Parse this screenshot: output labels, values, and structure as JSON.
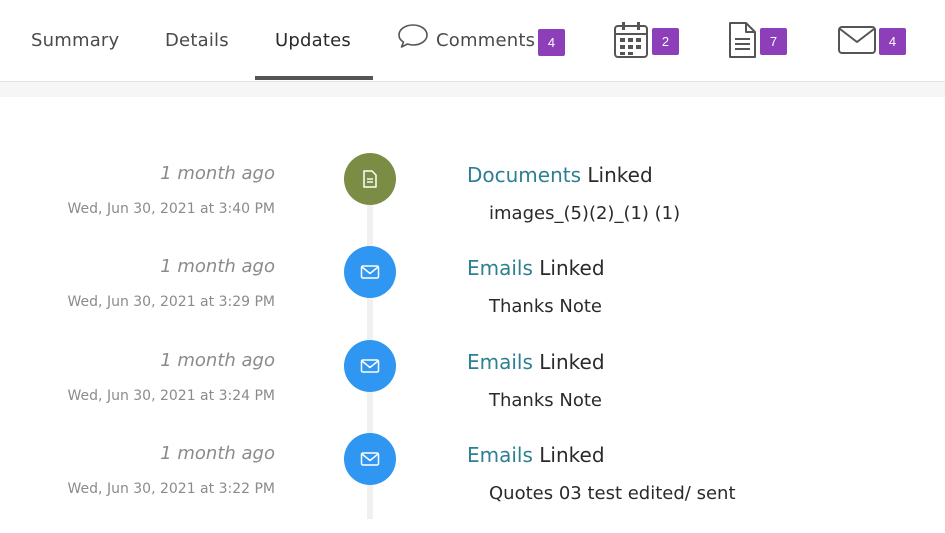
{
  "tabs": {
    "summary": "Summary",
    "details": "Details",
    "updates": "Updates",
    "comments": "Comments",
    "comments_count": "4",
    "calendar_count": "2",
    "documents_count": "7",
    "emails_count": "4",
    "active": "Updates"
  },
  "icons": {
    "comment": "comment-bubble-icon",
    "calendar": "calendar-icon",
    "document": "document-icon",
    "email": "envelope-icon"
  },
  "colors": {
    "badge": "#8c3fb8",
    "link": "#2d7f92",
    "document_dot": "#7b8c45",
    "email_dot": "#2f96f2"
  },
  "entries": [
    {
      "relative_time": "1 month ago",
      "timestamp": "Wed, Jun 30, 2021 at 3:40 PM",
      "kind": "Documents",
      "action": " Linked",
      "detail": "images_(5)(2)_(1) (1)",
      "icon": "document-icon"
    },
    {
      "relative_time": "1 month ago",
      "timestamp": "Wed, Jun 30, 2021 at 3:29 PM",
      "kind": "Emails",
      "action": " Linked",
      "detail": "Thanks Note",
      "icon": "envelope-icon"
    },
    {
      "relative_time": "1 month ago",
      "timestamp": "Wed, Jun 30, 2021 at 3:24 PM",
      "kind": "Emails",
      "action": " Linked",
      "detail": "Thanks Note",
      "icon": "envelope-icon"
    },
    {
      "relative_time": "1 month ago",
      "timestamp": "Wed, Jun 30, 2021 at 3:22 PM",
      "kind": "Emails",
      "action": " Linked",
      "detail": "Quotes 03 test edited/ sent",
      "icon": "envelope-icon"
    }
  ]
}
